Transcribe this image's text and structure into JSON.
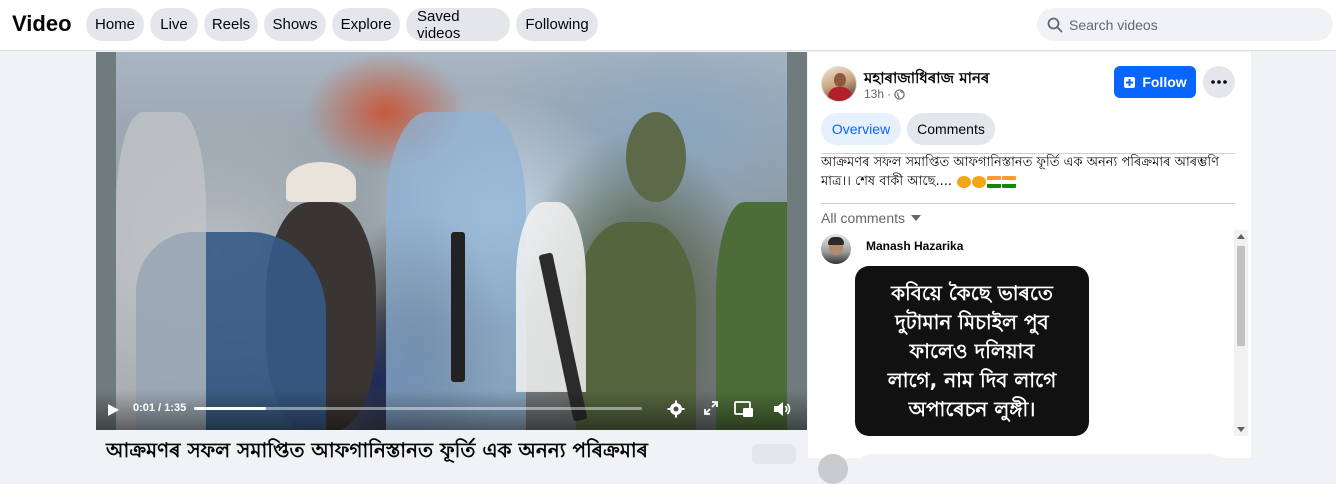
{
  "header": {
    "title": "Video",
    "tabs": [
      "Home",
      "Live",
      "Reels",
      "Shows",
      "Explore",
      "Saved videos",
      "Following"
    ],
    "search_placeholder": "Search videos"
  },
  "video": {
    "current_time": "0:01 / 1:35",
    "progress_fraction": 0.16,
    "caption": "আক্ৰমণৰ সফল সমাপ্তিত আফগানিস্তানত ফূৰ্তি এক অনন্য পৰিক্ৰমাৰ"
  },
  "post": {
    "author": "মহাৰাজাধিৰাজ মানৰ",
    "time": "13h",
    "follow_label": "Follow",
    "tabs": [
      "Overview",
      "Comments"
    ],
    "text": "আক্ৰমণৰ সফল সমাপ্তিত আফগানিস্তানত ফূৰ্তি এক অনন্য পৰিক্ৰমাৰ আৰম্ভণি মাত্ৰ।। শেষ বাকী আছে....",
    "all_comments_label": "All comments"
  },
  "comment": {
    "author": "Manash Hazarika",
    "image_text": "কবিয়ে কৈছে ভাৰতে\nদুটামান মিচাইল পুব\nফালেও দলিয়াব\nলাগে, নাম দিব লাগে\nঅপাৰেচন লুঙ্গী।"
  },
  "colors": {
    "accent": "#0866ff",
    "tab_bg": "#e4e6eb",
    "page_bg": "#f0f2f5"
  }
}
